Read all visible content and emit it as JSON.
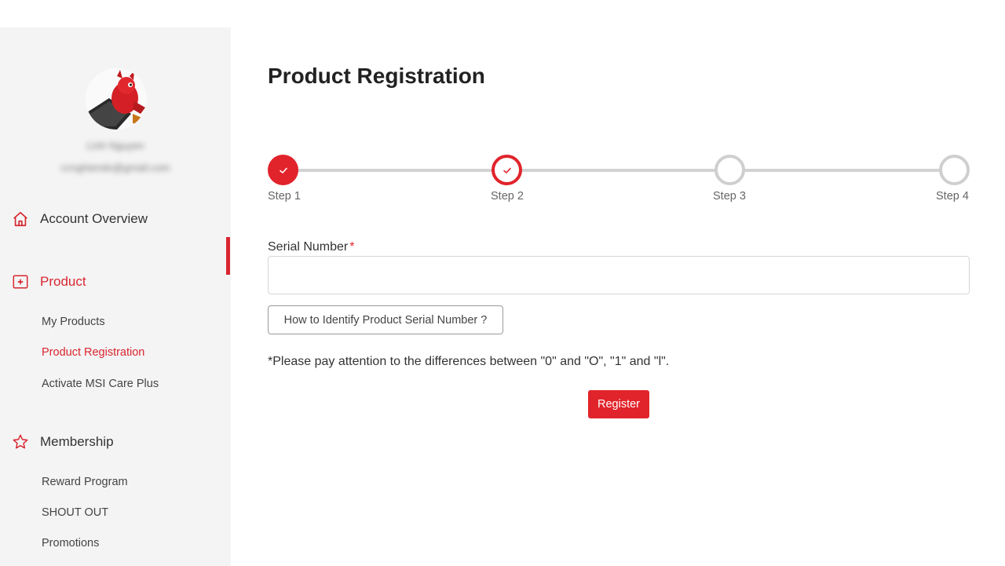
{
  "sidebar": {
    "user": {
      "name": "Linh Nguyen",
      "email": "ccnghiendo@gmail.com"
    },
    "sections": [
      {
        "label": "Account Overview",
        "icon": "home-icon"
      },
      {
        "label": "Product",
        "icon": "product-icon"
      },
      {
        "label": "Membership",
        "icon": "star-icon"
      }
    ],
    "product_items": [
      {
        "label": "My Products"
      },
      {
        "label": "Product Registration"
      },
      {
        "label": "Activate MSI Care Plus"
      }
    ],
    "membership_items": [
      {
        "label": "Reward Program"
      },
      {
        "label": "SHOUT OUT"
      },
      {
        "label": "Promotions"
      }
    ],
    "active_section": "Product",
    "active_item": "Product Registration"
  },
  "main": {
    "title": "Product Registration",
    "steps": [
      {
        "label": "Step 1",
        "state": "done"
      },
      {
        "label": "Step 2",
        "state": "current"
      },
      {
        "label": "Step 3",
        "state": "todo"
      },
      {
        "label": "Step 4",
        "state": "todo"
      }
    ],
    "serial": {
      "label": "Serial Number",
      "required_mark": "*",
      "value": ""
    },
    "howto_label": "How to Identify Product Serial Number ?",
    "note": "*Please pay attention to the differences between \"0\" and \"O\", \"1\" and \"l\".",
    "register_label": "Register"
  },
  "colors": {
    "accent": "#e1232b",
    "sidebar_bg": "#f4f4f4",
    "step_inactive": "#cfcfcf"
  }
}
